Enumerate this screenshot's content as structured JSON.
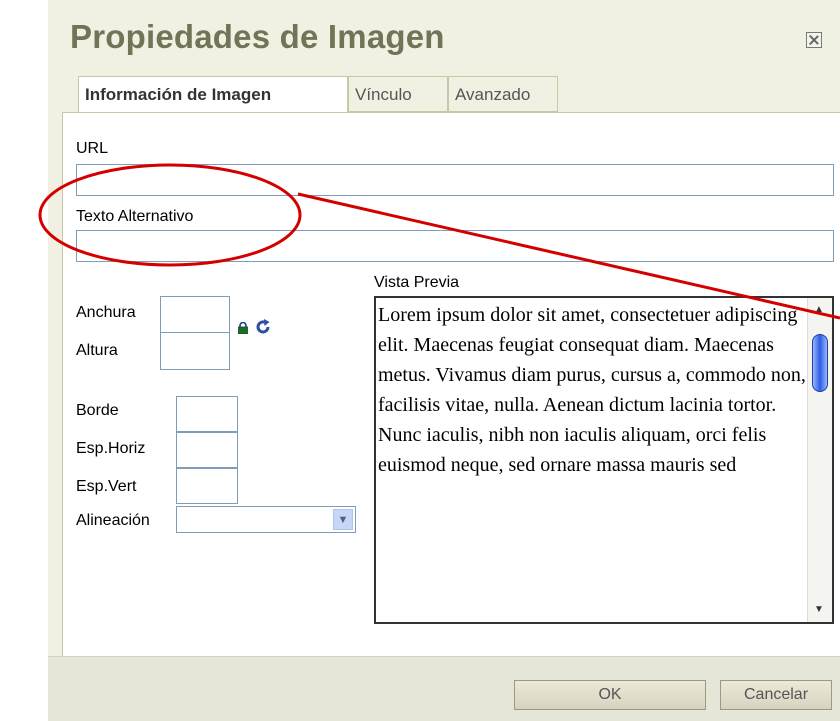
{
  "dialog": {
    "title": "Propiedades de Imagen",
    "close_icon": "close-icon"
  },
  "tabs": [
    {
      "label": "Información de Imagen",
      "active": true
    },
    {
      "label": "Vínculo",
      "active": false
    },
    {
      "label": "Avanzado",
      "active": false
    }
  ],
  "fields": {
    "url_label": "URL",
    "url_value": "",
    "alt_label": "Texto Alternativo",
    "alt_value": "",
    "width_label": "Anchura",
    "height_label": "Altura",
    "border_label": "Borde",
    "hspace_label": "Esp.Horiz",
    "vspace_label": "Esp.Vert",
    "align_label": "Alineación",
    "align_value": ""
  },
  "preview": {
    "label": "Vista Previa",
    "text": "Lorem ipsum dolor sit amet, consectetuer adipiscing elit. Maecenas feugiat consequat diam. Maecenas metus. Vivamus diam purus, cursus a, commodo non, facilisis vitae, nulla. Aenean dictum lacinia tortor. Nunc iaculis, nibh non iaculis aliquam, orci felis euismod neque, sed ornare massa mauris sed"
  },
  "icons": {
    "lock": "lock-icon",
    "reset": "refresh-icon",
    "select_arrow": "chevron-down-icon"
  },
  "buttons": {
    "ok": "OK",
    "cancel": "Cancelar"
  },
  "colors": {
    "title": "#737357",
    "annotation": "#d40000",
    "scroll_thumb": "#2c5ce8"
  }
}
